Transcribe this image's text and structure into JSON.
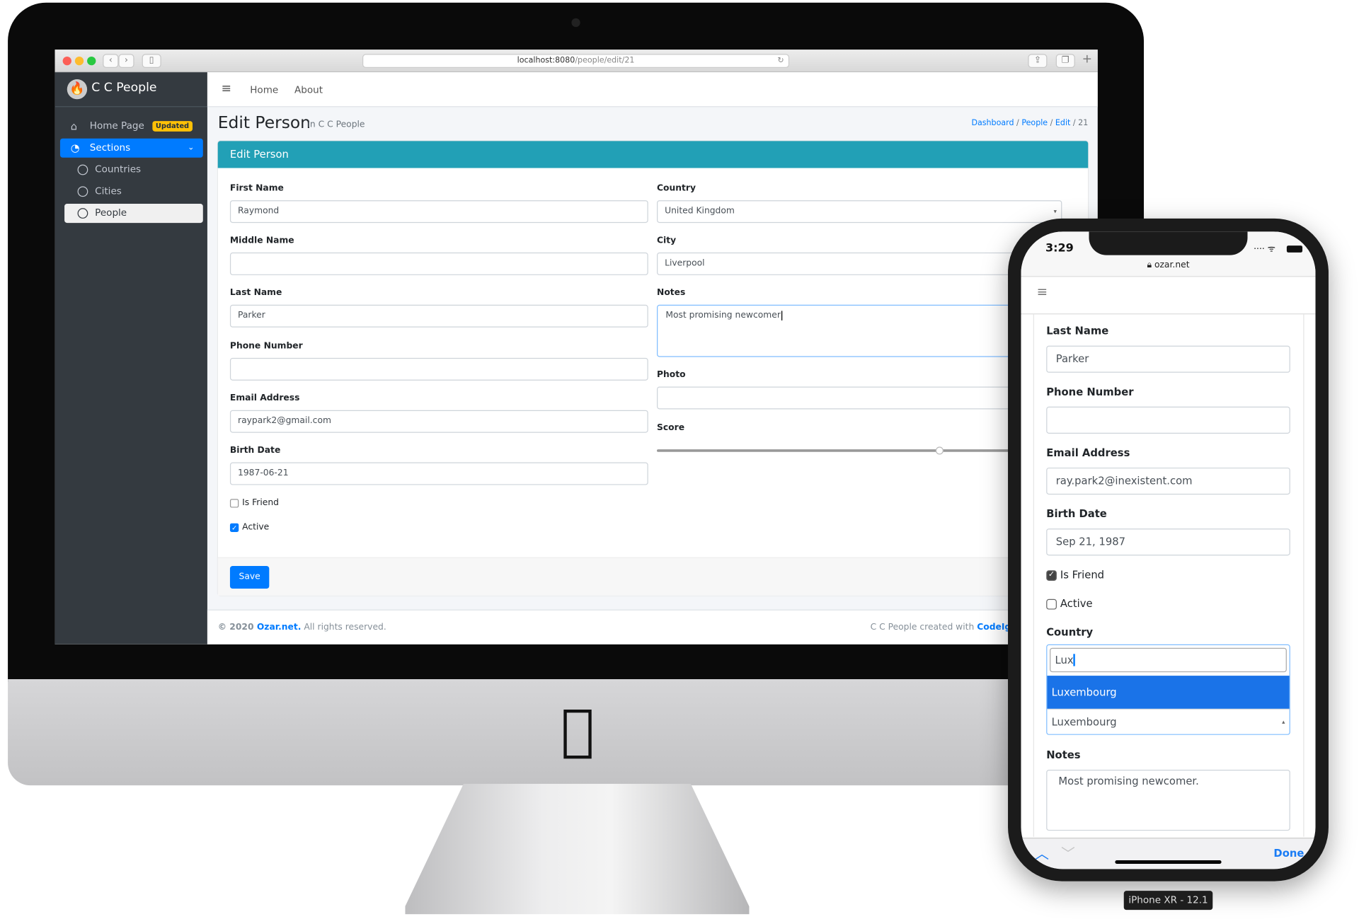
{
  "browser": {
    "url_host": "localhost:8080",
    "url_path": "/people/edit/21"
  },
  "sidebar": {
    "brand": "C C People",
    "items": [
      {
        "label": "Home Page",
        "badge": "Updated",
        "icon": "home-icon"
      },
      {
        "label": "Sections",
        "icon": "tachometer-icon",
        "active": true
      },
      {
        "label": "Countries",
        "icon": "circle-icon"
      },
      {
        "label": "Cities",
        "icon": "circle-icon"
      },
      {
        "label": "People",
        "icon": "circle-icon",
        "selected": true
      }
    ]
  },
  "navbar": {
    "links": [
      "Home",
      "About"
    ]
  },
  "page": {
    "title": "Edit Person",
    "subtitle": "in C C People",
    "breadcrumb": [
      "Dashboard",
      "People",
      "Edit",
      "21"
    ],
    "card_title": "Edit Person"
  },
  "form": {
    "first_name": {
      "label": "First Name",
      "value": "Raymond"
    },
    "middle_name": {
      "label": "Middle Name",
      "value": ""
    },
    "last_name": {
      "label": "Last Name",
      "value": "Parker"
    },
    "phone": {
      "label": "Phone Number",
      "value": ""
    },
    "email": {
      "label": "Email Address",
      "value": "raypark2@gmail.com"
    },
    "birth_date": {
      "label": "Birth Date",
      "value": "1987-06-21"
    },
    "is_friend": {
      "label": "Is Friend",
      "checked": false
    },
    "active": {
      "label": "Active",
      "checked": true
    },
    "country": {
      "label": "Country",
      "value": "United Kingdom"
    },
    "city": {
      "label": "City",
      "value": "Liverpool"
    },
    "notes": {
      "label": "Notes",
      "value": "Most promising newcomer"
    },
    "photo": {
      "label": "Photo",
      "value": ""
    },
    "score": {
      "label": "Score",
      "value_fraction": 0.79
    },
    "save_label": "Save"
  },
  "footer": {
    "copyright": "© 2020 ",
    "site": "Ozar.net.",
    "rights": " All rights reserved.",
    "credit": "C C People created with ",
    "framework": "CodeIgni"
  },
  "phone": {
    "time": "3:29",
    "domain": "ozar.net",
    "last_name": {
      "label": "Last Name",
      "value": "Parker"
    },
    "phone": {
      "label": "Phone Number",
      "value": ""
    },
    "email": {
      "label": "Email Address",
      "value": "ray.park2@inexistent.com"
    },
    "birth_date": {
      "label": "Birth Date",
      "value": "Sep 21, 1987"
    },
    "is_friend": {
      "label": "Is Friend",
      "checked": true
    },
    "active": {
      "label": "Active",
      "checked": false
    },
    "country": {
      "label": "Country",
      "search": "Lux",
      "highlighted_option": "Luxembourg",
      "selected": "Luxembourg"
    },
    "notes": {
      "label": "Notes",
      "value": "Most promising newcomer."
    },
    "done_label": "Done",
    "device_label": "iPhone XR - 12.1"
  },
  "colors": {
    "primary": "#007bff",
    "card_header": "#22a0b6",
    "sidebar": "#343a40",
    "badge": "#ffc107"
  }
}
